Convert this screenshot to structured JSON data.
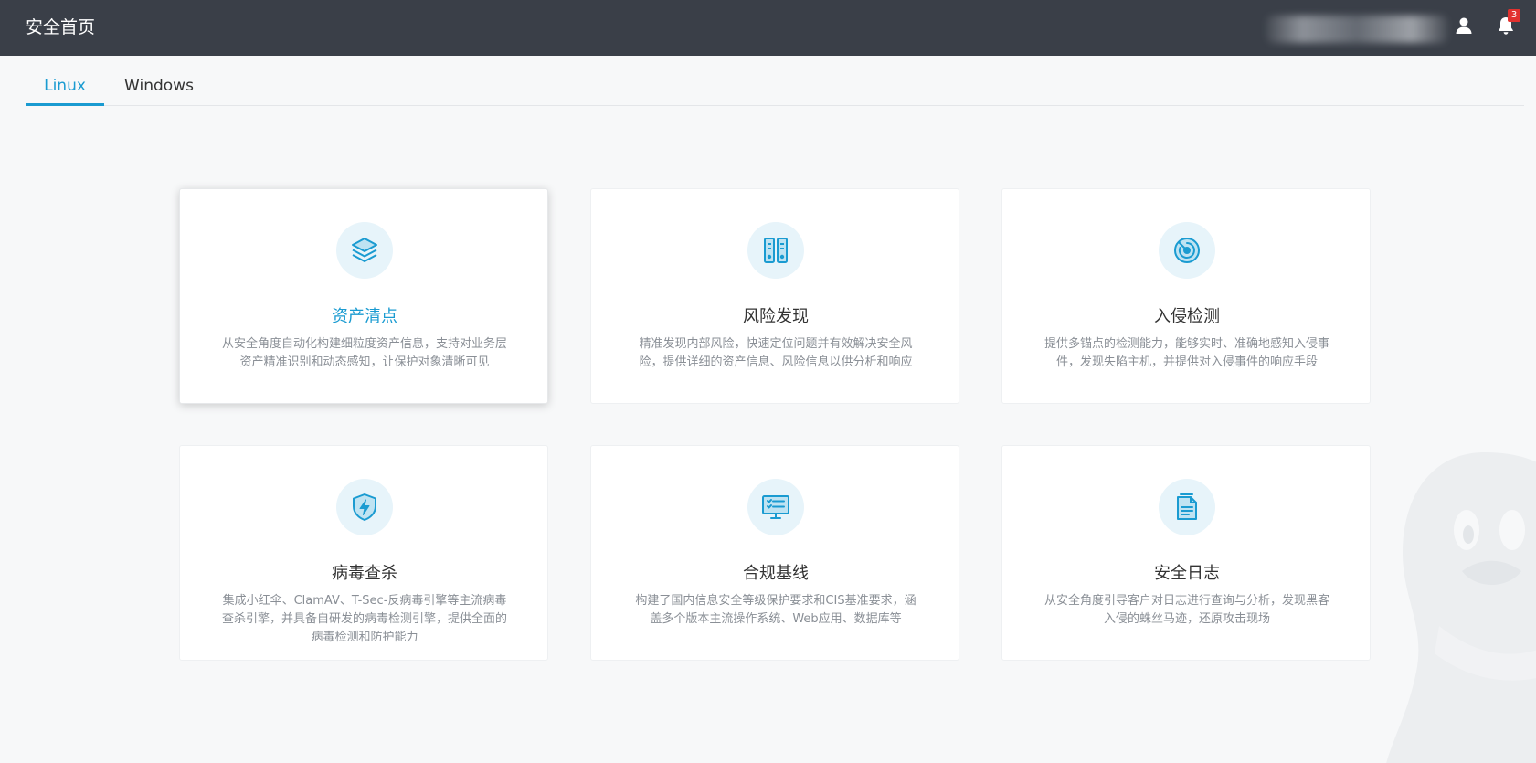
{
  "header": {
    "title": "安全首页",
    "notification_count": "3"
  },
  "tabs": [
    {
      "label": "Linux",
      "active": true
    },
    {
      "label": "Windows",
      "active": false
    }
  ],
  "cards": [
    {
      "title": "资产清点",
      "desc": "从安全角度自动化构建细粒度资产信息，支持对业务层资产精准识别和动态感知，让保护对象清晰可见",
      "icon": "layers-icon"
    },
    {
      "title": "风险发现",
      "desc": "精准发现内部风险，快速定位问题并有效解决安全风险，提供详细的资产信息、风险信息以供分析和响应",
      "icon": "server-icon"
    },
    {
      "title": "入侵检测",
      "desc": "提供多锚点的检测能力，能够实时、准确地感知入侵事件，发现失陷主机，并提供对入侵事件的响应手段",
      "icon": "radar-icon"
    },
    {
      "title": "病毒查杀",
      "desc": "集成小红伞、ClamAV、T-Sec-反病毒引擎等主流病毒查杀引擎，并具备自研发的病毒检测引擎，提供全面的病毒检测和防护能力",
      "icon": "shield-bolt-icon"
    },
    {
      "title": "合规基线",
      "desc": "构建了国内信息安全等级保护要求和CIS基准要求，涵盖多个版本主流操作系统、Web应用、数据库等",
      "icon": "monitor-checklist-icon"
    },
    {
      "title": "安全日志",
      "desc": "从安全角度引导客户对日志进行查询与分析，发现黑客入侵的蛛丝马迹，还原攻击现场",
      "icon": "document-icon"
    }
  ],
  "colors": {
    "header_bg": "#3a3f48",
    "accent": "#1a9bd1",
    "badge": "#e2312e"
  }
}
